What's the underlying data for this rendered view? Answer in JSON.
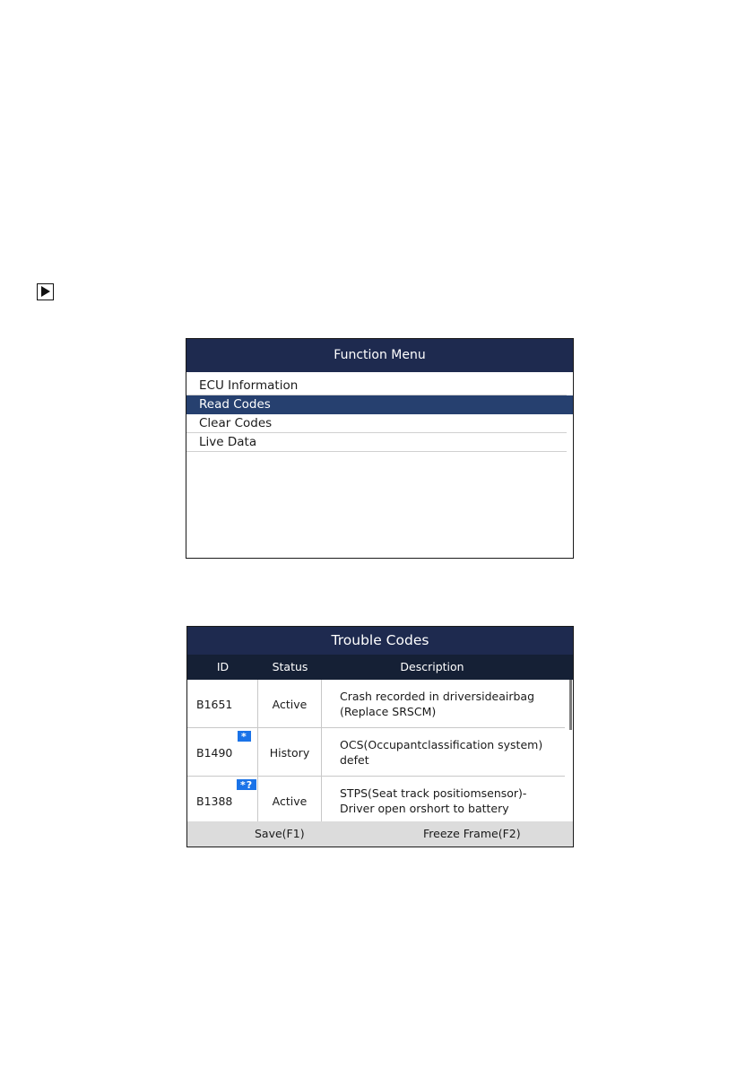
{
  "function_menu": {
    "title": "Function Menu",
    "items": [
      {
        "label": "ECU Information",
        "selected": false
      },
      {
        "label": "Read Codes",
        "selected": true
      },
      {
        "label": "Clear Codes",
        "selected": false
      },
      {
        "label": "Live Data",
        "selected": false
      }
    ]
  },
  "trouble_codes": {
    "title": "Trouble Codes",
    "columns": {
      "id": "ID",
      "status": "Status",
      "description": "Description"
    },
    "rows": [
      {
        "id": "B1651",
        "status": "Active",
        "badge": "",
        "description_line1": "Crash recorded in driversideairbag",
        "description_line2": "(Replace SRSCM)"
      },
      {
        "id": "B1490",
        "status": "History",
        "badge": "*",
        "description_line1": "OCS(Occupantclassification system)",
        "description_line2": "defet"
      },
      {
        "id": "B1388",
        "status": "Active",
        "badge": "*?",
        "description_line1": "STPS(Seat track positiomsensor)-",
        "description_line2": "Driver open orshort to battery"
      }
    ],
    "footer": {
      "save_label": "Save(F1)",
      "freeze_label": "Freeze Frame(F2)"
    }
  },
  "colors": {
    "title_bar": "#1e2a4f",
    "selected_row": "#26406f",
    "badge": "#1a73e8",
    "footer": "#dcdcdc"
  },
  "icons": {
    "bullet": "play-icon"
  }
}
